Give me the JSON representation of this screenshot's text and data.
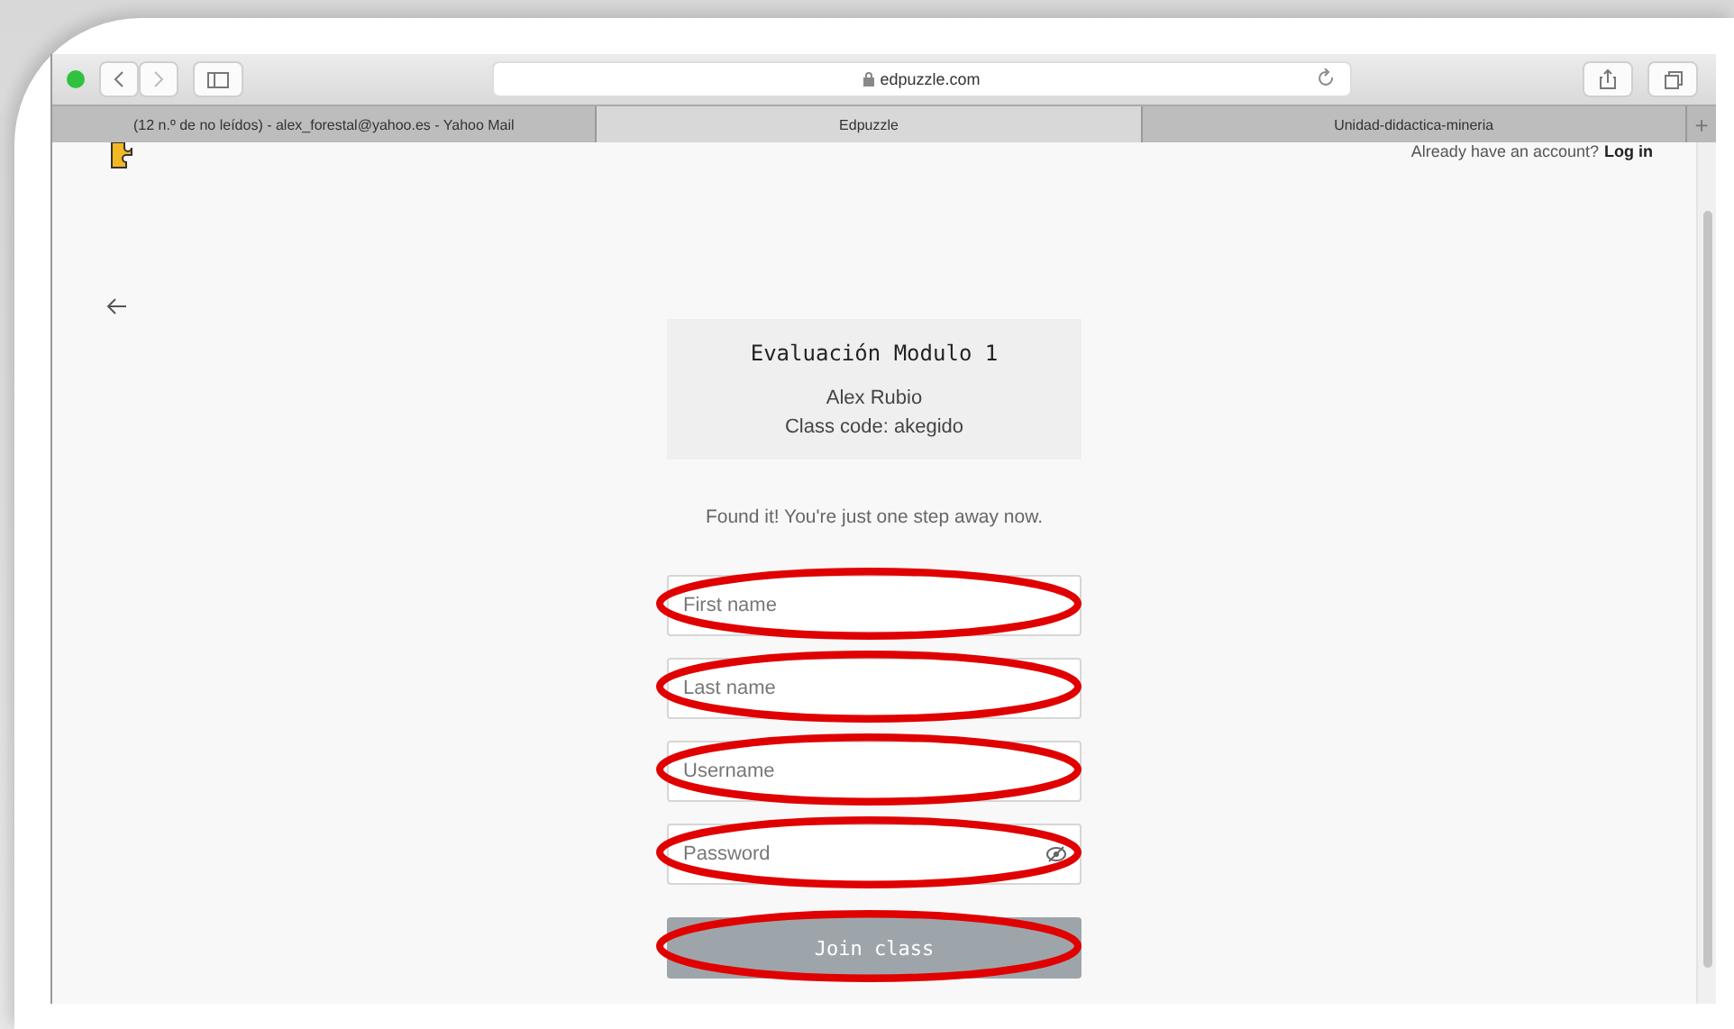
{
  "browser": {
    "address": "edpuzzle.com",
    "tabs": [
      {
        "label": "(12 n.º de no leídos) - alex_forestal@yahoo.es - Yahoo Mail",
        "selected": false
      },
      {
        "label": "Edpuzzle",
        "selected": true
      },
      {
        "label": "Unidad-didactica-mineria",
        "selected": false
      }
    ],
    "new_tab": "+"
  },
  "header": {
    "prompt": "Already have an account?",
    "link": "Log in"
  },
  "class_card": {
    "title": "Evaluación Modulo 1",
    "teacher": "Alex Rubio",
    "code": "Class code: akegido"
  },
  "message": "Found it! You're just one step away now.",
  "fields": [
    {
      "placeholder": "First name",
      "kind": "text",
      "circled": true
    },
    {
      "placeholder": "Last name",
      "kind": "text",
      "circled": true
    },
    {
      "placeholder": "Username",
      "kind": "text",
      "circled": true
    },
    {
      "placeholder": "Password",
      "kind": "password",
      "circled": true
    }
  ],
  "submit": {
    "label": "Join class",
    "disabled": true,
    "circled": true
  }
}
